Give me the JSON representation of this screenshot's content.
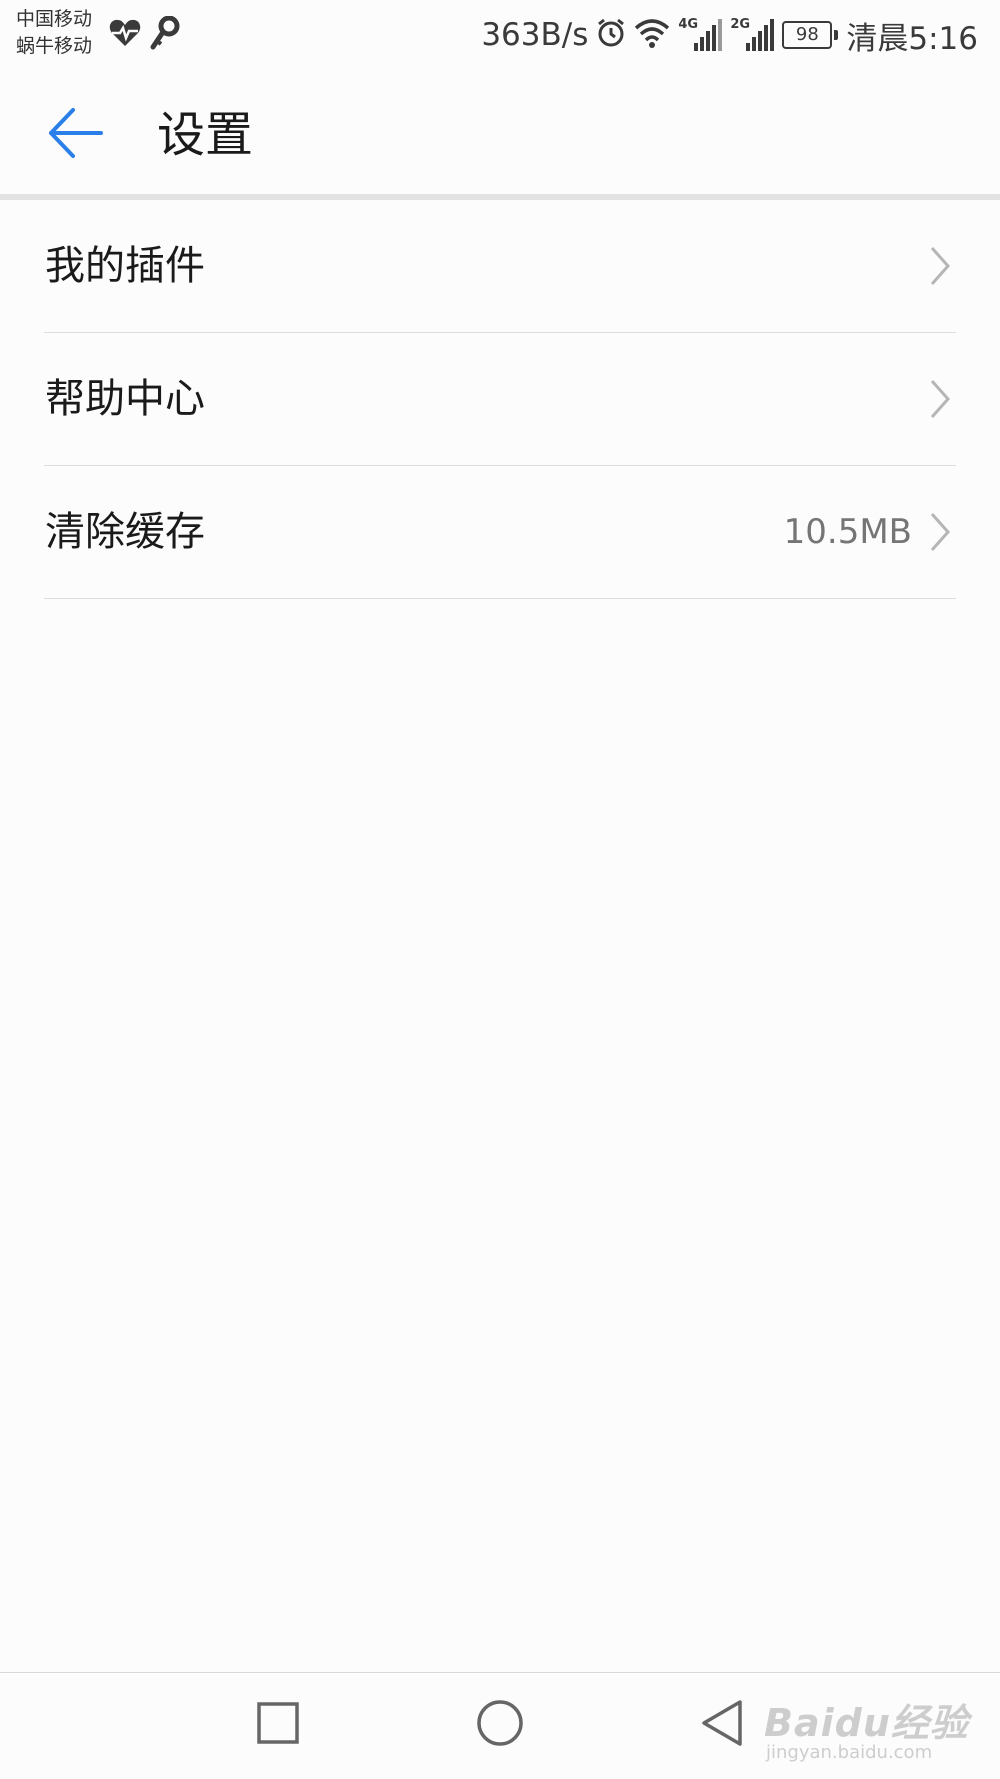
{
  "status_bar": {
    "carrier_1": "中国移动",
    "carrier_2": "蜗牛移动",
    "network_speed": "363B/s",
    "signal_1_tag": "4G",
    "signal_2_tag": "2G",
    "battery_level": "98",
    "time": "清晨5:16",
    "icons": [
      "heart-rate-icon",
      "key-icon",
      "alarm-icon",
      "wifi-icon",
      "signal-icon",
      "battery-icon"
    ]
  },
  "app_bar": {
    "title": "设置",
    "accent_color": "#2a7fe8"
  },
  "settings": {
    "items": [
      {
        "label": "我的插件",
        "value": ""
      },
      {
        "label": "帮助中心",
        "value": ""
      },
      {
        "label": "清除缓存",
        "value": "10.5MB"
      }
    ]
  },
  "nav_bar": {
    "buttons": [
      "recent-apps",
      "home",
      "back"
    ]
  },
  "watermark": {
    "main": "Baidu经验",
    "sub": "jingyan.baidu.com"
  }
}
